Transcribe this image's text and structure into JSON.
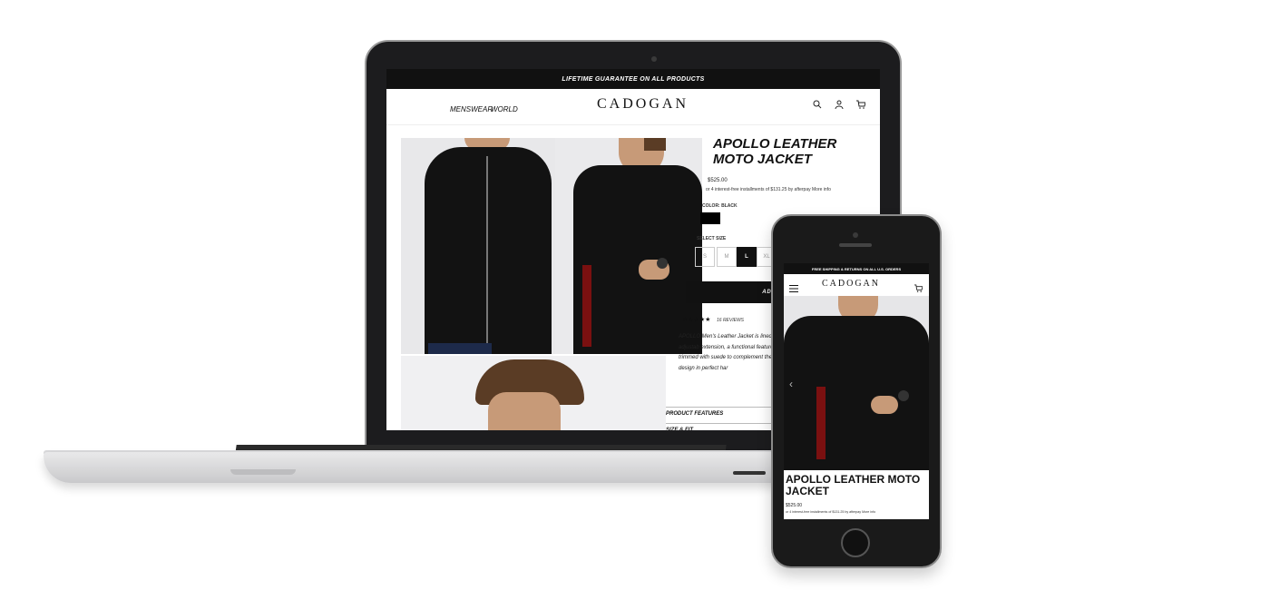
{
  "laptop": {
    "announcement": "LIFETIME GUARANTEE ON ALL PRODUCTS",
    "nav": {
      "links": [
        "MENSWEAR",
        "WORLD"
      ],
      "logo": "CADOGAN",
      "search_icon": "search-icon",
      "account_icon": "user-icon",
      "cart_icon": "cart-icon"
    },
    "product": {
      "title": "APOLLO LEATHER MOTO JACKET",
      "price": "$525.00",
      "installments": "or 4 interest-free installments of $131.25 by afterpay More info",
      "color_label": "COLOR: BLACK",
      "color_swatch": "#000000",
      "size_label": "SELECT SIZE",
      "sizes": [
        "S",
        "M",
        "L",
        "XL"
      ],
      "selected_size": "L",
      "add_to_cart": "ADD TO CAR",
      "stars": "★★★★★",
      "reviews": "16 REVIEWS",
      "description": "APOLLO Men's Leather Jacket is lined w and innovatively finished with an adjustab extension, a functional feature to provide layering. APOLLO's cuffs are trimmed with suede to complement the midnight black N shell. Enjoy power and design in perfect har",
      "accordion": [
        "PRODUCT FEATURES",
        "SIZE & FIT"
      ]
    }
  },
  "phone": {
    "announcement": "FREE SHIPPING & RETURNS ON ALL U.S. ORDERS",
    "logo": "CADOGAN",
    "menu_icon": "hamburger-icon",
    "cart_icon": "cart-icon",
    "title": "APOLLO LEATHER MOTO JACKET",
    "price": "$525.00",
    "installments": "or 4 interest-free installments of $131.25 by afterpay More info"
  }
}
